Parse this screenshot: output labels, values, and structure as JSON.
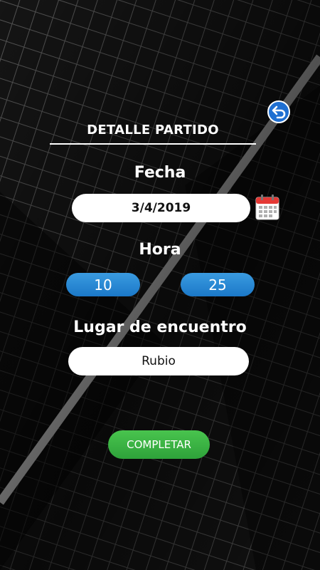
{
  "header": {
    "title": "DETALLE PARTIDO",
    "back_icon": "back-arrow-icon"
  },
  "form": {
    "date_label": "Fecha",
    "date_value": "3/4/2019",
    "calendar_icon": "calendar-icon",
    "time_label": "Hora",
    "hour_value": "10",
    "minute_value": "25",
    "place_label": "Lugar de encuentro",
    "place_value": "Rubio"
  },
  "actions": {
    "complete_label": "COMPLETAR"
  },
  "colors": {
    "accent_blue": "#1b78c8",
    "accent_green": "#2ea23a",
    "background": "#0b0b0b"
  }
}
